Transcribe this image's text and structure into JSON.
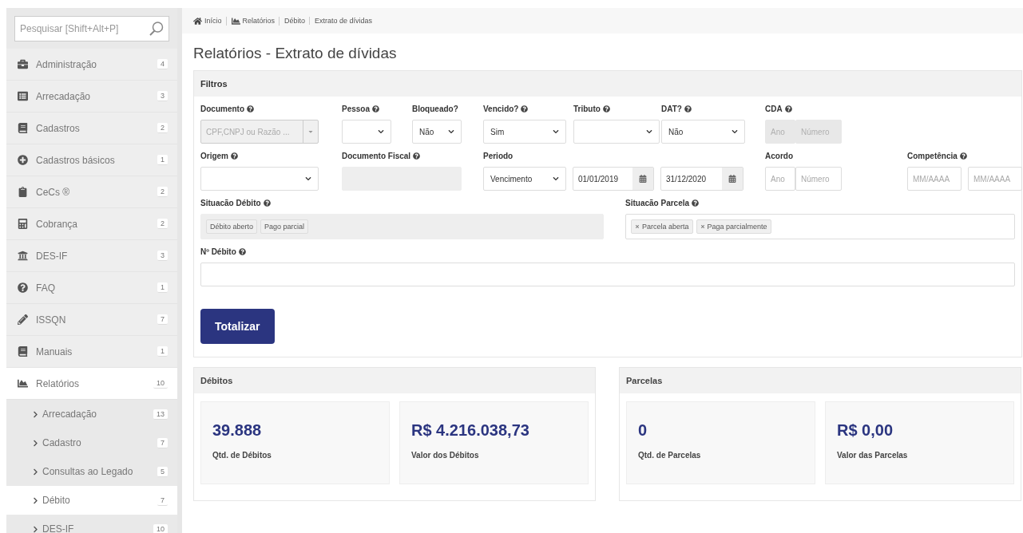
{
  "sidebar": {
    "search": {
      "placeholder": "Pesquisar [Shift+Alt+P]"
    },
    "items": [
      {
        "label": "Administração",
        "count": "4",
        "selected": false
      },
      {
        "label": "Arrecadação",
        "count": "3",
        "selected": false
      },
      {
        "label": "Cadastros",
        "count": "2",
        "selected": false
      },
      {
        "label": "Cadastros básicos",
        "count": "1",
        "selected": false
      },
      {
        "label": "CeCs ®",
        "count": "2",
        "selected": false
      },
      {
        "label": "Cobrança",
        "count": "2",
        "selected": false
      },
      {
        "label": "DES-IF",
        "count": "3",
        "selected": false
      },
      {
        "label": "FAQ",
        "count": "1",
        "selected": false
      },
      {
        "label": "ISSQN",
        "count": "7",
        "selected": false
      },
      {
        "label": "Manuais",
        "count": "1",
        "selected": false
      },
      {
        "label": "Relatórios",
        "count": "10",
        "selected": true,
        "children": [
          {
            "label": "Arrecadação",
            "count": "13",
            "selected": false
          },
          {
            "label": "Cadastro",
            "count": "7",
            "selected": false
          },
          {
            "label": "Consultas ao Legado",
            "count": "5",
            "selected": false
          },
          {
            "label": "Débito",
            "count": "7",
            "selected": true
          },
          {
            "label": "DES-IF",
            "count": "10",
            "selected": false
          }
        ]
      }
    ]
  },
  "breadcrumb": [
    "Início",
    "Relatórios",
    "Débito",
    "Extrato de dívidas"
  ],
  "page_title": "Relatórios - Extrato de dívidas",
  "filters": {
    "title": "Filtros",
    "fields": [
      {
        "label": "Documento",
        "help": true,
        "kind": "combo",
        "placeholder": "CPF,CNPJ ou Razão ..."
      },
      {
        "label": "Pessoa",
        "help": true,
        "kind": "select"
      },
      {
        "label": "Bloqueado?",
        "help": false,
        "kind": "select",
        "value": "Não"
      },
      {
        "label": "Vencido?",
        "help": true,
        "kind": "select",
        "value": "Sim"
      },
      {
        "label": "Tributo",
        "help": true,
        "kind": "select"
      },
      {
        "label": "DAT?",
        "help": true,
        "kind": "select",
        "value": "Não"
      },
      {
        "label": "CDA",
        "help": true,
        "kind": "pair",
        "disabled": true,
        "placeholders": [
          "Ano",
          "Número"
        ]
      },
      {
        "label": "Origem",
        "help": true,
        "kind": "select"
      },
      {
        "label": "Documento Fiscal",
        "help": true,
        "kind": "text",
        "disabled": true
      },
      {
        "label": "Periodo",
        "help": false,
        "kind": "period",
        "value": "Vencimento",
        "dates": [
          "01/01/2019",
          "31/12/2020"
        ]
      },
      {
        "label": "Acordo",
        "help": false,
        "kind": "pair",
        "disabled": false,
        "placeholders": [
          "Ano",
          "Número"
        ]
      },
      {
        "label": "Competência",
        "help": true,
        "kind": "months",
        "placeholders": [
          "MM/AAAA",
          "MM/AAAA"
        ]
      },
      {
        "label": "Situacão Débito",
        "help": true,
        "kind": "tags",
        "disabled": true,
        "tags": [
          "Débito aberto",
          "Pago parcial"
        ]
      },
      {
        "label": "Situacão Parcela",
        "help": true,
        "kind": "tags",
        "disabled": false,
        "tags": [
          "Parcela aberta",
          "Paga parcialmente"
        ]
      },
      {
        "label": "Nº Débito",
        "help": true,
        "kind": "text",
        "disabled": false
      }
    ],
    "button": "Totalizar"
  },
  "summaries": [
    {
      "title": "Débitos",
      "stats": [
        {
          "value": "39.888",
          "label": "Qtd. de Débitos"
        },
        {
          "value": "R$ 4.216.038,73",
          "label": "Valor dos Débitos"
        }
      ]
    },
    {
      "title": "Parcelas",
      "stats": [
        {
          "value": "0",
          "label": "Qtd. de Parcelas"
        },
        {
          "value": "R$ 0,00",
          "label": "Valor das Parcelas"
        }
      ]
    }
  ]
}
